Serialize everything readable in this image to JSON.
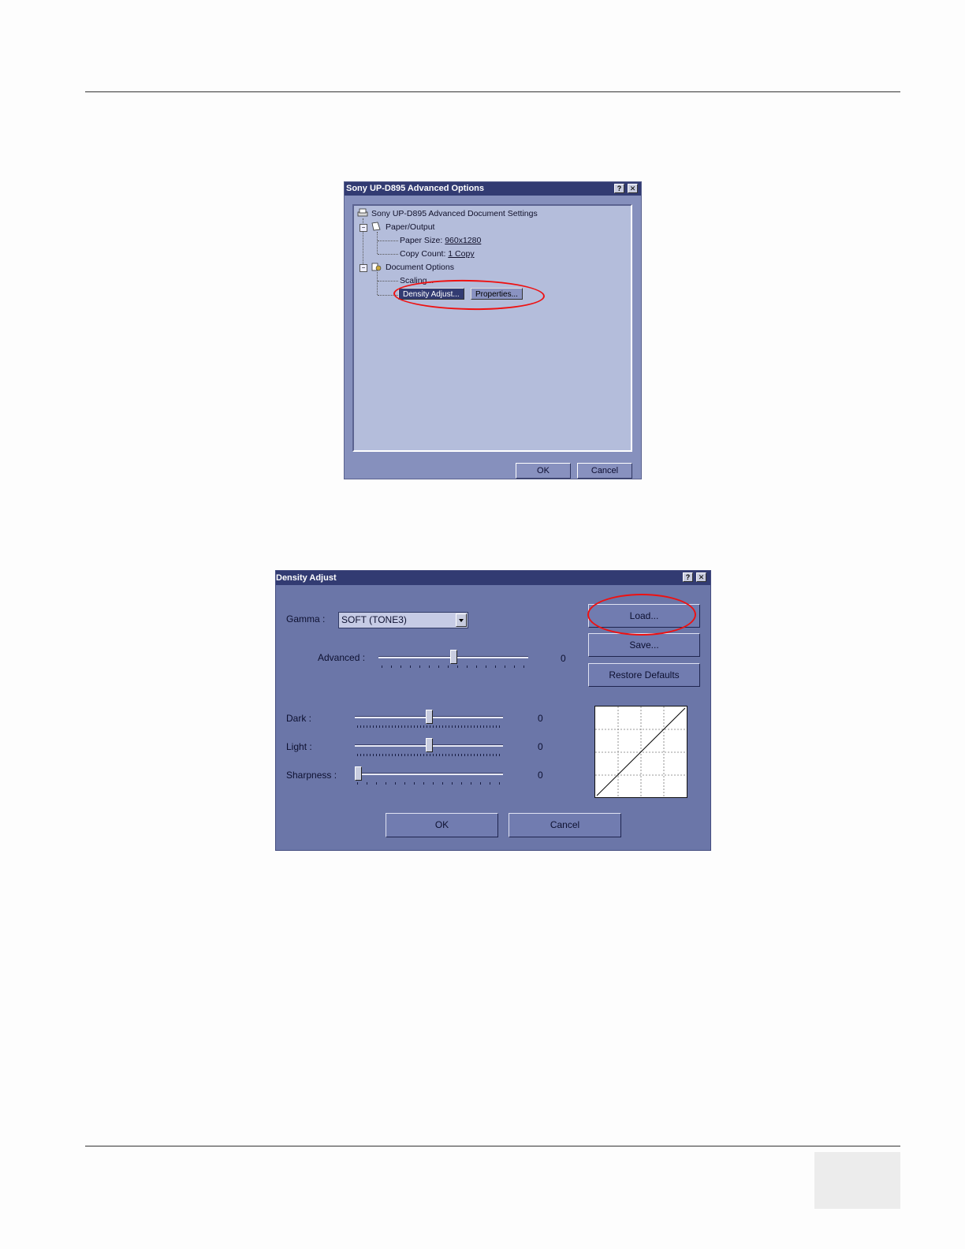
{
  "dialog1": {
    "title": "Sony UP-D895 Advanced Options",
    "help_glyph": "?",
    "close_glyph": "✕",
    "tree": {
      "root": "Sony UP-D895 Advanced Document Settings",
      "paper_output": "Paper/Output",
      "paper_size_label": "Paper Size:",
      "paper_size_value": "960x1280",
      "copy_count_label": "Copy Count:",
      "copy_count_value": "1 Copy",
      "document_options": "Document Options",
      "scaling": "Scaling...",
      "density_adjust": "Density Adjust...",
      "properties": "Properties..."
    },
    "ok": "OK",
    "cancel": "Cancel"
  },
  "dialog2": {
    "title": "Density Adjust",
    "help_glyph": "?",
    "close_glyph": "✕",
    "gamma_label": "Gamma :",
    "gamma_value": "SOFT (TONE3)",
    "advanced_label": "Advanced :",
    "advanced_value": "0",
    "dark_label": "Dark :",
    "dark_value": "0",
    "light_label": "Light :",
    "light_value": "0",
    "sharpness_label": "Sharpness :",
    "sharpness_value": "0",
    "load": "Load...",
    "save": "Save...",
    "restore_defaults": "Restore Defaults",
    "ok": "OK",
    "cancel": "Cancel",
    "slider_levels": {
      "advanced": 0.5,
      "dark": 0.5,
      "light": 0.5,
      "sharpness": 0.0
    }
  },
  "colors": {
    "highlight_circle": "#e11111",
    "title_bar": "#323b72"
  }
}
